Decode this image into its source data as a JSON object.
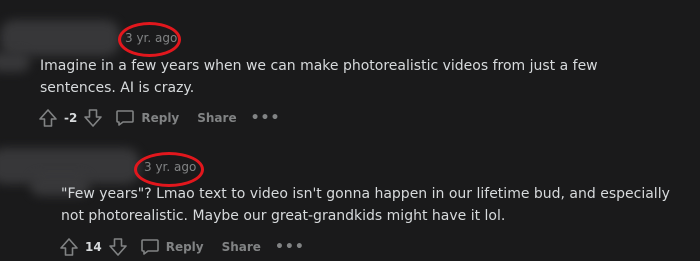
{
  "comments": [
    {
      "timestamp": "3 yr. ago",
      "text": "Imagine in a few years when we can make photorealistic videos from just a few sentences. AI is crazy.",
      "score": "-2",
      "reply_label": "Reply",
      "share_label": "Share",
      "more_label": "•••"
    },
    {
      "timestamp": "3 yr. ago",
      "text": "\"Few years\"? Lmao text to video isn't gonna happen in our lifetime bud, and especially not photorealistic. Maybe our great-grandkids might have it lol.",
      "score": "14",
      "reply_label": "Reply",
      "share_label": "Share",
      "more_label": "•••"
    }
  ],
  "colors": {
    "background": "#1a1a1b",
    "text": "#d7dadc",
    "muted": "#818384",
    "annotation_circle": "#e2171d"
  }
}
